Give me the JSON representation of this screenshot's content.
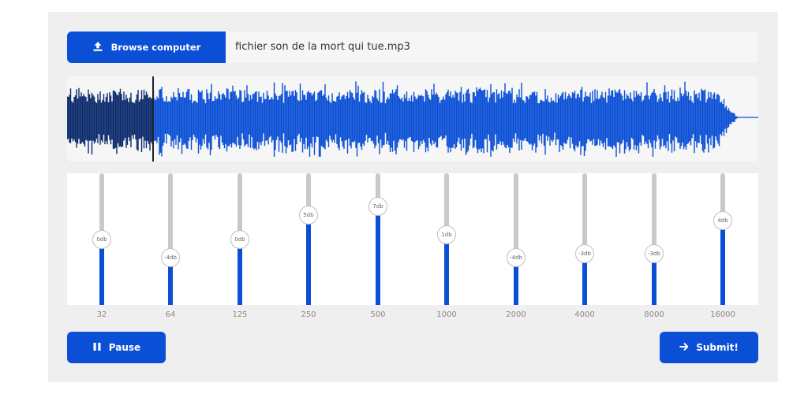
{
  "file": {
    "browse_label": "Browse computer",
    "browse_icon": "upload-icon",
    "file_name": "fichier son de la mort qui tue.mp3"
  },
  "waveform": {
    "played_color": "#0b2a6b",
    "unplayed_color": "#0a4fd6",
    "played_fraction": 0.124
  },
  "equalizer": {
    "bands": [
      {
        "freq": "32",
        "gain_label": "0db",
        "level": 0.5
      },
      {
        "freq": "64",
        "gain_label": "-4db",
        "level": 0.36
      },
      {
        "freq": "125",
        "gain_label": "0db",
        "level": 0.5
      },
      {
        "freq": "250",
        "gain_label": "5db",
        "level": 0.68
      },
      {
        "freq": "500",
        "gain_label": "7db",
        "level": 0.75
      },
      {
        "freq": "1000",
        "gain_label": "1db",
        "level": 0.53
      },
      {
        "freq": "2000",
        "gain_label": "-4db",
        "level": 0.36
      },
      {
        "freq": "4000",
        "gain_label": "-3db",
        "level": 0.39
      },
      {
        "freq": "8000",
        "gain_label": "-3db",
        "level": 0.39
      },
      {
        "freq": "16000",
        "gain_label": "4db",
        "level": 0.64
      }
    ]
  },
  "controls": {
    "pause_label": "Pause",
    "pause_icon": "pause-icon",
    "submit_label": "Submit!",
    "submit_icon": "arrow-right-icon"
  },
  "colors": {
    "accent": "#0a4fd6",
    "panel_bg": "#efefef",
    "track": "#c9c9c9"
  }
}
